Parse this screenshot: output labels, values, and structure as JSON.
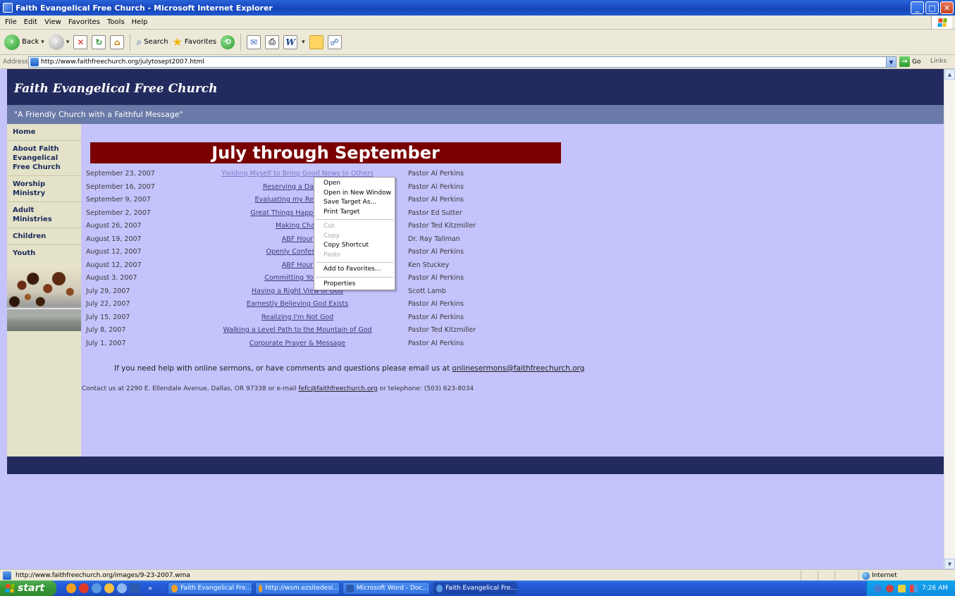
{
  "window": {
    "title": "Faith Evangelical Free Church - Microsoft Internet Explorer",
    "controls": [
      "_",
      "□",
      "✕"
    ]
  },
  "menu": [
    "File",
    "Edit",
    "View",
    "Favorites",
    "Tools",
    "Help"
  ],
  "toolbar": {
    "back": "Back",
    "search": "Search",
    "favorites": "Favorites"
  },
  "address": {
    "label": "Address",
    "url": "http://www.faithfreechurch.org/julytosept2007.html",
    "go": "Go",
    "links": "Links"
  },
  "site": {
    "title": "Faith Evangelical Free Church",
    "tagline": "\"A Friendly Church with a Faithful Message\"",
    "nav": [
      {
        "label": "Home"
      },
      {
        "label": "About Faith Evangelical Free Church"
      },
      {
        "label": "Worship Ministry"
      },
      {
        "label": "Adult Ministries"
      },
      {
        "label": "Children"
      },
      {
        "label": "Youth"
      }
    ]
  },
  "content": {
    "banner": "July through September",
    "sermons": [
      {
        "date": "September 23, 2007",
        "title": "Yielding Myself to Bring Good News to Others",
        "speaker": "Pastor Al Perkins"
      },
      {
        "date": "September 16, 2007",
        "title": "Reserving a Daily Tir",
        "speaker": "Pastor Al Perkins"
      },
      {
        "date": "September 9, 2007",
        "title": "Evaluating my Relationsh",
        "speaker": "Pastor Al Perkins"
      },
      {
        "date": "September 2, 2007",
        "title": "Great Things Happen Becau",
        "speaker": "Pastor Ed Sutter"
      },
      {
        "date": "August 26, 2007",
        "title": "Making Chan",
        "speaker": "Pastor Ted Kitzmiller"
      },
      {
        "date": "August 19, 2007",
        "title": "ABF Hour",
        "speaker": "Dr. Ray Tallman"
      },
      {
        "date": "August 12, 2007",
        "title": "Openly Confessing",
        "speaker": "Pastor Al Perkins"
      },
      {
        "date": "August 12, 2007",
        "title": "ABF Hour",
        "speaker": "Ken Stuckey"
      },
      {
        "date": "August 3, 2007",
        "title": "Committing Your Lif",
        "speaker": "Pastor Al Perkins"
      },
      {
        "date": "July 29, 2007",
        "title": "Having a Right View of God",
        "speaker": "Scott Lamb"
      },
      {
        "date": "July 22, 2007",
        "title": "Earnestly Believing God Exists",
        "speaker": "Pastor Al Perkins"
      },
      {
        "date": "July 15, 2007",
        "title": "Realizing I'm Not God",
        "speaker": "Pastor Al Perkins"
      },
      {
        "date": "July 8, 2007",
        "title": "Walking a Level Path to the Mountain of God",
        "speaker": "Pastor Ted Kitzmiller"
      },
      {
        "date": "July 1, 2007",
        "title": "Corporate Prayer & Message",
        "speaker": "Pastor Al Perkins"
      }
    ],
    "help_text": "If you need help with online sermons, or have comments and questions please email us at",
    "help_email": "onlinesermons@faithfreechurch.org",
    "contact_pre": "Contact us at 2290 E. Ellendale Avenue, Dallas, OR 97338 or e-mail",
    "contact_email": "fefc@faithfreechurch.org",
    "contact_post": "or telephone: (503) 623-8034"
  },
  "context_menu": {
    "items": [
      {
        "label": "Open",
        "enabled": true
      },
      {
        "label": "Open in New Window",
        "enabled": true
      },
      {
        "label": "Save Target As...",
        "enabled": true
      },
      {
        "label": "Print Target",
        "enabled": true
      },
      {
        "label": "Cut",
        "enabled": false
      },
      {
        "label": "Copy",
        "enabled": false
      },
      {
        "label": "Copy Shortcut",
        "enabled": true
      },
      {
        "label": "Paste",
        "enabled": false
      },
      {
        "label": "Add to Favorites...",
        "enabled": true
      },
      {
        "label": "Properties",
        "enabled": true
      }
    ]
  },
  "status": {
    "text": "http://www.faithfreechurch.org/images/9-23-2007.wma",
    "zone": "Internet"
  },
  "taskbar": {
    "start": "start",
    "tasks": [
      "Faith Evangelical Fre...",
      "http://wsm.ezsitedesi...",
      "Microsoft Word - Doc...",
      "Faith Evangelical Fre..."
    ],
    "clock": "7:26 AM"
  },
  "colors": {
    "header": "#232b5e",
    "tagline": "#6a7aa8",
    "page_bg": "#c4c3fc",
    "sidebar": "#e4e2c8",
    "banner": "#7a0000"
  }
}
